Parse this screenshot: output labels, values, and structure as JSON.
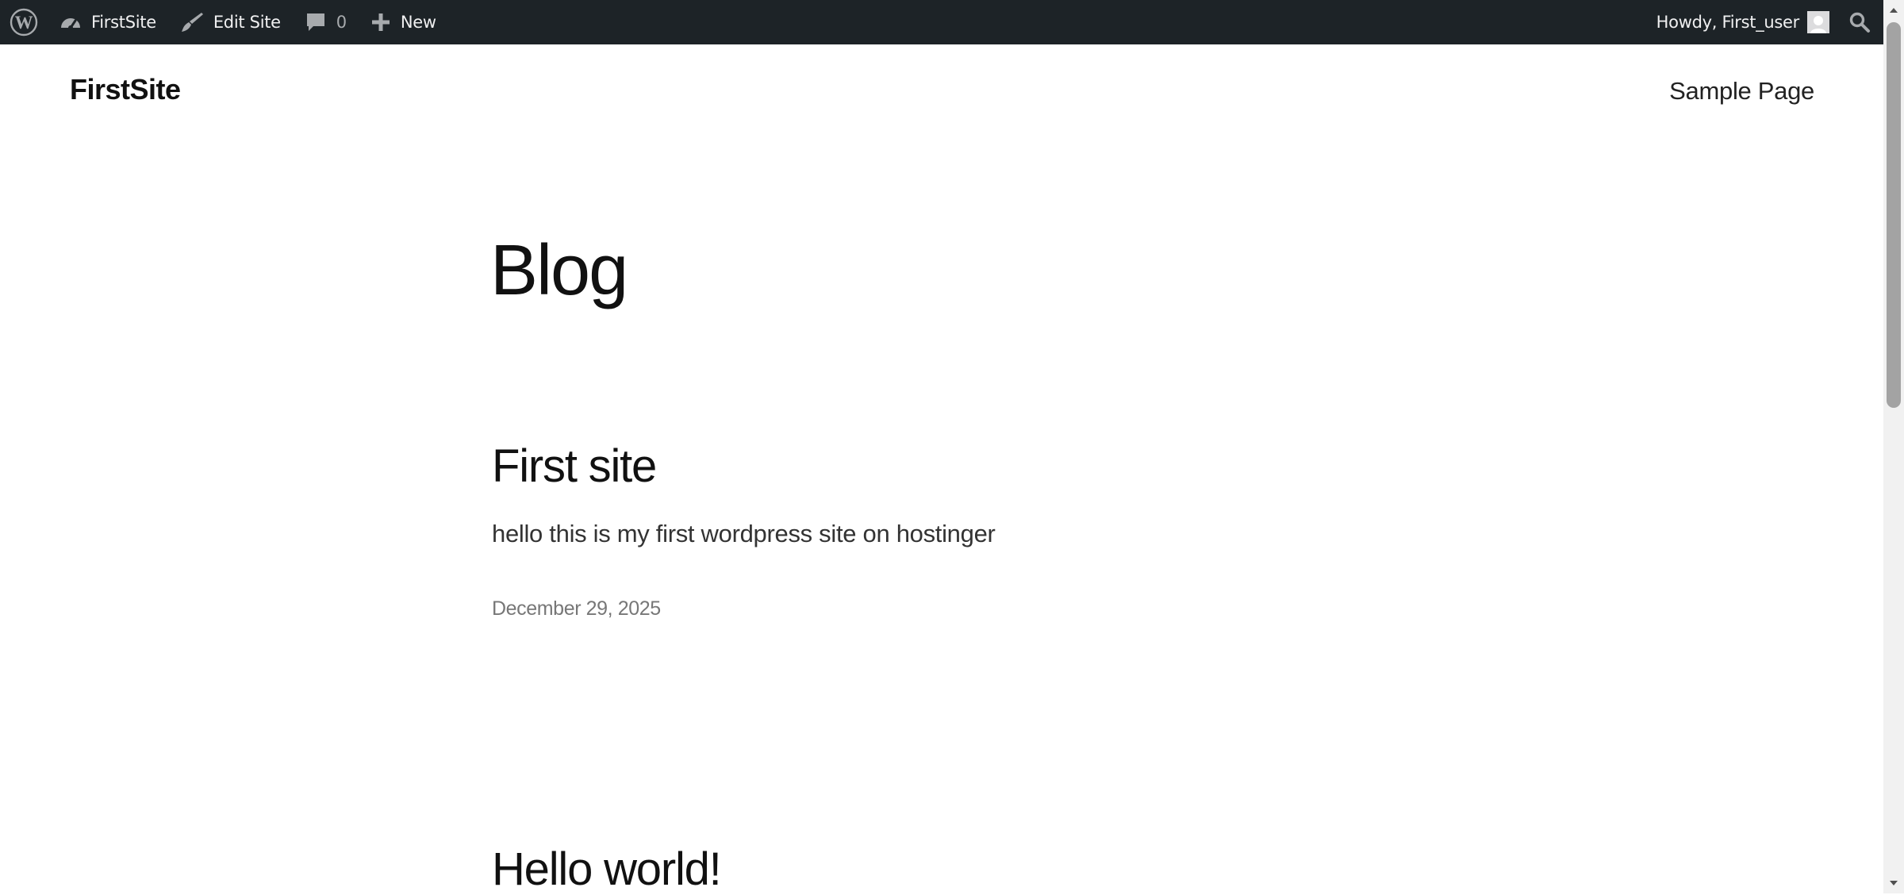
{
  "admin_bar": {
    "site_name": "FirstSite",
    "edit_site": "Edit Site",
    "comments_count": "0",
    "new_label": "New",
    "greeting": "Howdy, First_user"
  },
  "header": {
    "site_title": "FirstSite",
    "nav": [
      "Sample Page"
    ]
  },
  "main": {
    "heading": "Blog",
    "posts": [
      {
        "title": "First site",
        "excerpt": "hello this is my first wordpress site on hostinger",
        "date": "December 29, 2025"
      },
      {
        "title": "Hello world!"
      }
    ]
  },
  "colors": {
    "admin_bar_bg": "#1d2327",
    "admin_bar_text": "#f0f0f1",
    "text_primary": "#111111",
    "text_meta": "#777777"
  },
  "icons": [
    "wordpress-logo-icon",
    "dashboard-icon",
    "brush-icon",
    "comment-icon",
    "plus-icon",
    "avatar",
    "search-icon"
  ]
}
